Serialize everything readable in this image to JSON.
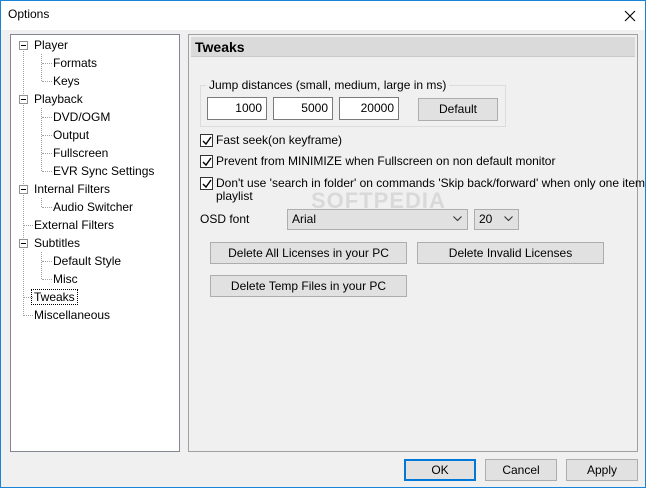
{
  "window": {
    "title": "Options"
  },
  "tree": {
    "items": [
      {
        "label": "Player"
      },
      {
        "label": "Formats"
      },
      {
        "label": "Keys"
      },
      {
        "label": "Playback"
      },
      {
        "label": "DVD/OGM"
      },
      {
        "label": "Output"
      },
      {
        "label": "Fullscreen"
      },
      {
        "label": "EVR Sync Settings"
      },
      {
        "label": "Internal Filters"
      },
      {
        "label": "Audio Switcher"
      },
      {
        "label": "External Filters"
      },
      {
        "label": "Subtitles"
      },
      {
        "label": "Default Style"
      },
      {
        "label": "Misc"
      },
      {
        "label": "Tweaks"
      },
      {
        "label": "Miscellaneous"
      }
    ]
  },
  "panel": {
    "title": "Tweaks",
    "jump": {
      "label": "Jump distances (small, medium, large in ms)",
      "small": "1000",
      "medium": "5000",
      "large": "20000",
      "default_label": "Default"
    },
    "fast_seek": {
      "label": "Fast seek(on keyframe)",
      "checked": true
    },
    "prevent_minimize": {
      "label": "Prevent from MINIMIZE when Fullscreen on non default monitor",
      "checked": true
    },
    "dont_use_search": {
      "label_line1": "Don't use 'search in folder' on commands 'Skip back/forward' when only one item in",
      "label_line2": "playlist",
      "checked": true
    },
    "osd_font": {
      "label": "OSD font",
      "font_value": "Arial",
      "size_value": "20"
    },
    "delete_all_licenses_label": "Delete All Licenses in your PC",
    "delete_invalid_licenses_label": "Delete Invalid Licenses",
    "delete_temp_files_label": "Delete Temp Files in your PC"
  },
  "watermark": "SOFTPEDIA",
  "footer": {
    "ok_label": "OK",
    "cancel_label": "Cancel",
    "apply_label": "Apply"
  },
  "colors": {
    "accent": "#0078d7",
    "panel_header": "#dadada"
  }
}
